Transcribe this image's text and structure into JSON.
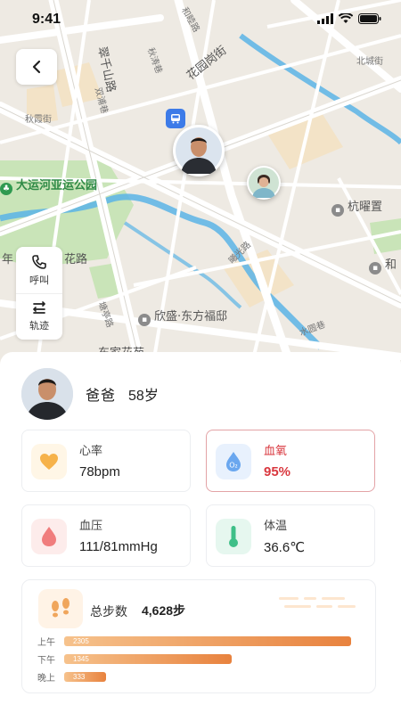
{
  "status_bar": {
    "time": "9:41"
  },
  "map": {
    "road_labels": [
      "和睦路",
      "花园岗街",
      "翠千山路",
      "北城街",
      "秋涛巷",
      "秋霞街",
      "双浦巷",
      "曦光路",
      "花路",
      "塘亭路",
      "水圆巷"
    ],
    "poi_labels": {
      "park": "大运河亚运公园",
      "hangyao": "杭曜置",
      "xinsheng": "欣盛·东方福邸",
      "dongjia": "东家花苑",
      "edge_left": "年",
      "edge_right": "和"
    },
    "tools": {
      "call": "呼叫",
      "track": "轨迹"
    }
  },
  "person": {
    "name": "爸爸",
    "age": "58岁"
  },
  "vitals": [
    {
      "label": "心率",
      "value": "78bpm",
      "icon": "heart-icon",
      "color": "#f6b24a",
      "bg": "#fff6e6",
      "alert": false
    },
    {
      "label": "血氧",
      "value": "95%",
      "icon": "oxygen-drop-icon",
      "color": "#6aa7ef",
      "bg": "#e8f1fd",
      "alert": true
    },
    {
      "label": "血压",
      "value": "111/81mmHg",
      "icon": "blood-drop-icon",
      "color": "#f07d7d",
      "bg": "#fdeceb",
      "alert": false
    },
    {
      "label": "体温",
      "value": "36.6℃",
      "icon": "thermometer-icon",
      "color": "#3fbf88",
      "bg": "#e6f7ef",
      "alert": false
    }
  ],
  "steps": {
    "title": "总步数",
    "total": "4,628步",
    "periods": [
      {
        "label": "上午",
        "value": 2305,
        "display": "2305"
      },
      {
        "label": "下午",
        "value": 1345,
        "display": "1345"
      },
      {
        "label": "晚上",
        "value": 333,
        "display": "333"
      }
    ]
  },
  "colors": {
    "alert": "#d9383f",
    "bar_start": "#f6c28c",
    "bar_end": "#e8823e",
    "river": "#5ab4e6",
    "park": "#c9e4b8"
  }
}
